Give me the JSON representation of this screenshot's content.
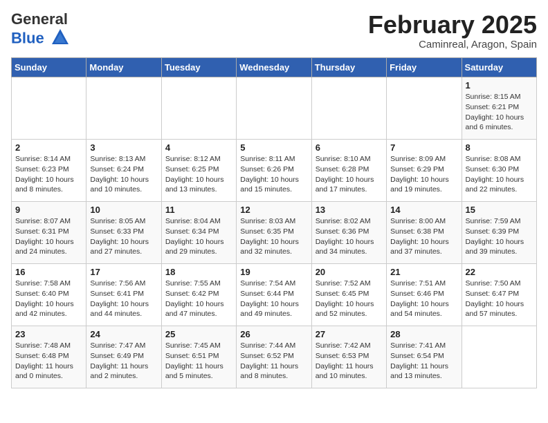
{
  "logo": {
    "general": "General",
    "blue": "Blue"
  },
  "title": "February 2025",
  "subtitle": "Caminreal, Aragon, Spain",
  "days_of_week": [
    "Sunday",
    "Monday",
    "Tuesday",
    "Wednesday",
    "Thursday",
    "Friday",
    "Saturday"
  ],
  "weeks": [
    [
      {
        "day": "",
        "info": ""
      },
      {
        "day": "",
        "info": ""
      },
      {
        "day": "",
        "info": ""
      },
      {
        "day": "",
        "info": ""
      },
      {
        "day": "",
        "info": ""
      },
      {
        "day": "",
        "info": ""
      },
      {
        "day": "1",
        "info": "Sunrise: 8:15 AM\nSunset: 6:21 PM\nDaylight: 10 hours\nand 6 minutes."
      }
    ],
    [
      {
        "day": "2",
        "info": "Sunrise: 8:14 AM\nSunset: 6:23 PM\nDaylight: 10 hours\nand 8 minutes."
      },
      {
        "day": "3",
        "info": "Sunrise: 8:13 AM\nSunset: 6:24 PM\nDaylight: 10 hours\nand 10 minutes."
      },
      {
        "day": "4",
        "info": "Sunrise: 8:12 AM\nSunset: 6:25 PM\nDaylight: 10 hours\nand 13 minutes."
      },
      {
        "day": "5",
        "info": "Sunrise: 8:11 AM\nSunset: 6:26 PM\nDaylight: 10 hours\nand 15 minutes."
      },
      {
        "day": "6",
        "info": "Sunrise: 8:10 AM\nSunset: 6:28 PM\nDaylight: 10 hours\nand 17 minutes."
      },
      {
        "day": "7",
        "info": "Sunrise: 8:09 AM\nSunset: 6:29 PM\nDaylight: 10 hours\nand 19 minutes."
      },
      {
        "day": "8",
        "info": "Sunrise: 8:08 AM\nSunset: 6:30 PM\nDaylight: 10 hours\nand 22 minutes."
      }
    ],
    [
      {
        "day": "9",
        "info": "Sunrise: 8:07 AM\nSunset: 6:31 PM\nDaylight: 10 hours\nand 24 minutes."
      },
      {
        "day": "10",
        "info": "Sunrise: 8:05 AM\nSunset: 6:33 PM\nDaylight: 10 hours\nand 27 minutes."
      },
      {
        "day": "11",
        "info": "Sunrise: 8:04 AM\nSunset: 6:34 PM\nDaylight: 10 hours\nand 29 minutes."
      },
      {
        "day": "12",
        "info": "Sunrise: 8:03 AM\nSunset: 6:35 PM\nDaylight: 10 hours\nand 32 minutes."
      },
      {
        "day": "13",
        "info": "Sunrise: 8:02 AM\nSunset: 6:36 PM\nDaylight: 10 hours\nand 34 minutes."
      },
      {
        "day": "14",
        "info": "Sunrise: 8:00 AM\nSunset: 6:38 PM\nDaylight: 10 hours\nand 37 minutes."
      },
      {
        "day": "15",
        "info": "Sunrise: 7:59 AM\nSunset: 6:39 PM\nDaylight: 10 hours\nand 39 minutes."
      }
    ],
    [
      {
        "day": "16",
        "info": "Sunrise: 7:58 AM\nSunset: 6:40 PM\nDaylight: 10 hours\nand 42 minutes."
      },
      {
        "day": "17",
        "info": "Sunrise: 7:56 AM\nSunset: 6:41 PM\nDaylight: 10 hours\nand 44 minutes."
      },
      {
        "day": "18",
        "info": "Sunrise: 7:55 AM\nSunset: 6:42 PM\nDaylight: 10 hours\nand 47 minutes."
      },
      {
        "day": "19",
        "info": "Sunrise: 7:54 AM\nSunset: 6:44 PM\nDaylight: 10 hours\nand 49 minutes."
      },
      {
        "day": "20",
        "info": "Sunrise: 7:52 AM\nSunset: 6:45 PM\nDaylight: 10 hours\nand 52 minutes."
      },
      {
        "day": "21",
        "info": "Sunrise: 7:51 AM\nSunset: 6:46 PM\nDaylight: 10 hours\nand 54 minutes."
      },
      {
        "day": "22",
        "info": "Sunrise: 7:50 AM\nSunset: 6:47 PM\nDaylight: 10 hours\nand 57 minutes."
      }
    ],
    [
      {
        "day": "23",
        "info": "Sunrise: 7:48 AM\nSunset: 6:48 PM\nDaylight: 11 hours\nand 0 minutes."
      },
      {
        "day": "24",
        "info": "Sunrise: 7:47 AM\nSunset: 6:49 PM\nDaylight: 11 hours\nand 2 minutes."
      },
      {
        "day": "25",
        "info": "Sunrise: 7:45 AM\nSunset: 6:51 PM\nDaylight: 11 hours\nand 5 minutes."
      },
      {
        "day": "26",
        "info": "Sunrise: 7:44 AM\nSunset: 6:52 PM\nDaylight: 11 hours\nand 8 minutes."
      },
      {
        "day": "27",
        "info": "Sunrise: 7:42 AM\nSunset: 6:53 PM\nDaylight: 11 hours\nand 10 minutes."
      },
      {
        "day": "28",
        "info": "Sunrise: 7:41 AM\nSunset: 6:54 PM\nDaylight: 11 hours\nand 13 minutes."
      },
      {
        "day": "",
        "info": ""
      }
    ]
  ]
}
